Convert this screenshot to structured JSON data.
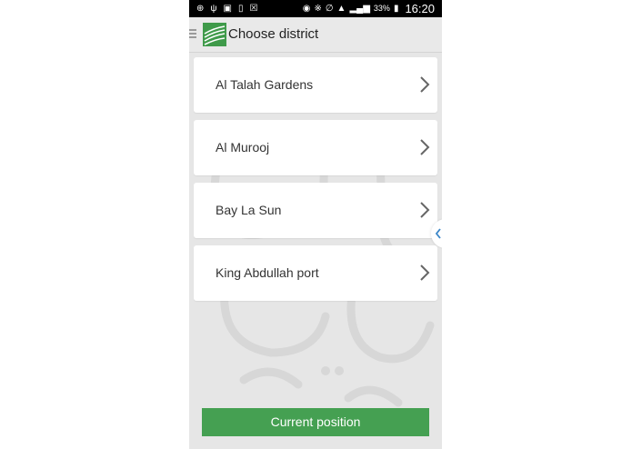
{
  "status_bar": {
    "battery_percent": "33%",
    "time": "16:20",
    "left_icons": [
      "gps-icon",
      "usb-icon",
      "image-icon",
      "sd-card-icon",
      "no-sim-icon"
    ],
    "right_icons": [
      "eye-icon",
      "bluetooth-icon",
      "mute-icon",
      "wifi-icon",
      "signal-icon",
      "battery-icon"
    ]
  },
  "action_bar": {
    "title": "Choose district"
  },
  "districts": [
    {
      "label": "Al Talah Gardens"
    },
    {
      "label": "Al Murooj"
    },
    {
      "label": "Bay La Sun"
    },
    {
      "label": "King Abdullah port"
    }
  ],
  "button": {
    "label": "Current position"
  },
  "colors": {
    "accent": "#45a052",
    "background": "#e6e6e6",
    "status_bar": "#000000"
  }
}
